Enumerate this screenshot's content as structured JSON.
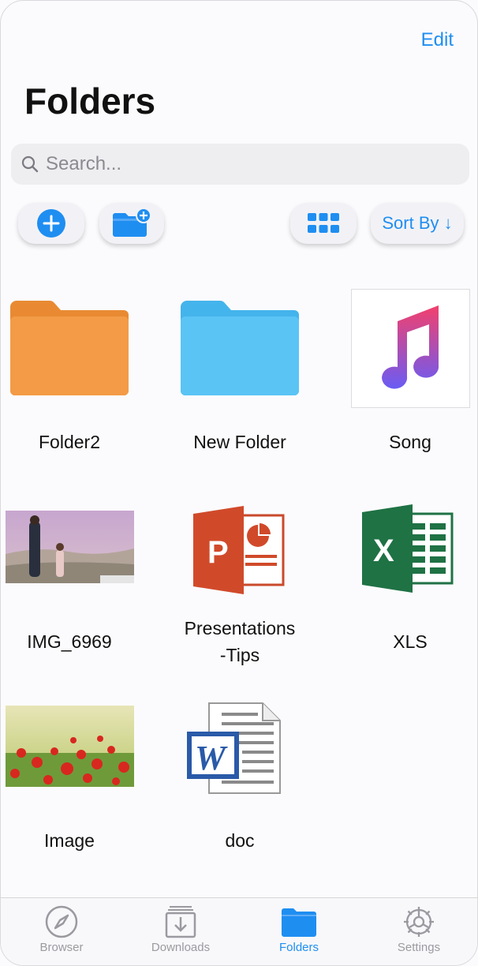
{
  "header": {
    "edit_label": "Edit",
    "title": "Folders"
  },
  "search": {
    "placeholder": "Search..."
  },
  "toolbar": {
    "add_icon": "plus-circle-icon",
    "new_folder_icon": "folder-plus-icon",
    "grid_icon": "grid-icon",
    "sort_label": "Sort By ↓"
  },
  "items": [
    {
      "label": "Folder2",
      "icon": "folder-icon",
      "color": "#f39b46"
    },
    {
      "label": "New Folder",
      "icon": "folder-icon",
      "color": "#5ac4f5"
    },
    {
      "label": "Song",
      "icon": "music-note-icon"
    },
    {
      "label": "IMG_6969",
      "icon": "photo-thumbnail"
    },
    {
      "label": "Presentations\n-Tips",
      "icon": "powerpoint-icon"
    },
    {
      "label": "XLS",
      "icon": "excel-icon"
    },
    {
      "label": "Image",
      "icon": "photo-thumbnail"
    },
    {
      "label": "doc",
      "icon": "word-icon"
    }
  ],
  "tabbar": {
    "tabs": [
      {
        "label": "Browser",
        "icon": "compass-icon",
        "active": false
      },
      {
        "label": "Downloads",
        "icon": "download-tray-icon",
        "active": false
      },
      {
        "label": "Folders",
        "icon": "folder-icon",
        "active": true
      },
      {
        "label": "Settings",
        "icon": "gear-icon",
        "active": false
      }
    ]
  },
  "colors": {
    "accent": "#1f8ef1",
    "inactive_tab": "#9a9aa0",
    "search_bg": "#eeeef1"
  }
}
